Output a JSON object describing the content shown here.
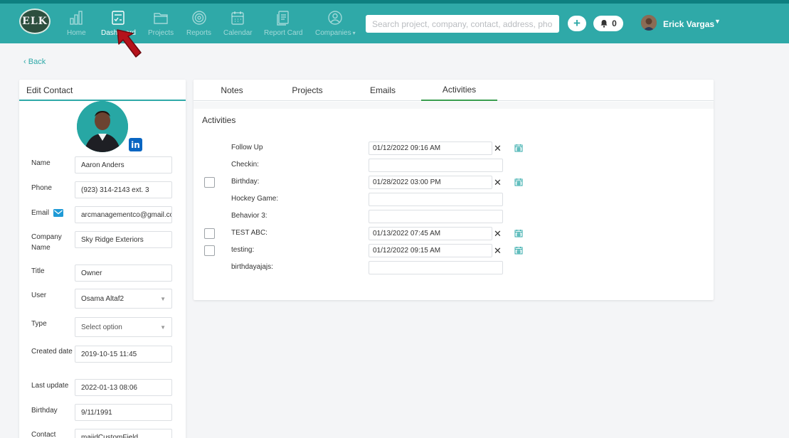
{
  "nav": {
    "logo_text": "ELK",
    "items": [
      {
        "label": "Home",
        "icon": "bar-chart-icon"
      },
      {
        "label": "Dashboard",
        "icon": "dashboard-icon"
      },
      {
        "label": "Projects",
        "icon": "folder-icon"
      },
      {
        "label": "Reports",
        "icon": "target-icon"
      },
      {
        "label": "Calendar",
        "icon": "calendar-icon"
      },
      {
        "label": "Report Card",
        "icon": "report-card-icon"
      },
      {
        "label": "Companies",
        "icon": "user-circle-icon"
      }
    ],
    "search_placeholder": "Search project, company, contact, address, pho",
    "plus_label": "+",
    "notification_count": "0",
    "user_name": "Erick Vargas",
    "accent_color": "#2fa9a8"
  },
  "back_label": "Back",
  "contact": {
    "header": "Edit Contact",
    "linkedin_label": "in",
    "fields": {
      "name_label": "Name",
      "name_value": "Aaron Anders",
      "phone_label": "Phone",
      "phone_value": "(923) 314-2143 ext. 3",
      "email_label": "Email",
      "email_value": "arcmanagementco@gmail.com",
      "company_label": "Company Name",
      "company_value": "Sky Ridge Exteriors",
      "title_label": "Title",
      "title_value": "Owner",
      "user_label": "User",
      "user_value": "Osama Altaf2",
      "type_label": "Type",
      "type_value": "Select option",
      "created_label": "Created date",
      "created_value": "2019-10-15 11:45",
      "updated_label": "Last update",
      "updated_value": "2022-01-13 08:06",
      "birthday_label": "Birthday",
      "birthday_value": "9/11/1991",
      "contact_label": "Contact",
      "contact_value": "majidCustomField"
    }
  },
  "tabs": [
    "Notes",
    "Projects",
    "Emails",
    "Activities"
  ],
  "active_tab": "Activities",
  "activities_title": "Activities",
  "activities": [
    {
      "label": "Follow Up",
      "value": "01/12/2022 09:16 AM",
      "has_checkbox": false,
      "has_date": true
    },
    {
      "label": "Checkin:",
      "value": "",
      "has_checkbox": false,
      "has_date": false
    },
    {
      "label": "Birthday:",
      "value": "01/28/2022 03:00 PM",
      "has_checkbox": true,
      "has_date": true
    },
    {
      "label": "Hockey Game:",
      "value": "",
      "has_checkbox": false,
      "has_date": false
    },
    {
      "label": "Behavior 3:",
      "value": "",
      "has_checkbox": false,
      "has_date": false
    },
    {
      "label": "TEST ABC:",
      "value": "01/13/2022 07:45 AM",
      "has_checkbox": true,
      "has_date": true
    },
    {
      "label": "testing:",
      "value": "01/12/2022 09:15 AM",
      "has_checkbox": true,
      "has_date": true
    },
    {
      "label": "birthdayajajs:",
      "value": "",
      "has_checkbox": false,
      "has_date": false
    }
  ],
  "clear_symbol": "✕"
}
